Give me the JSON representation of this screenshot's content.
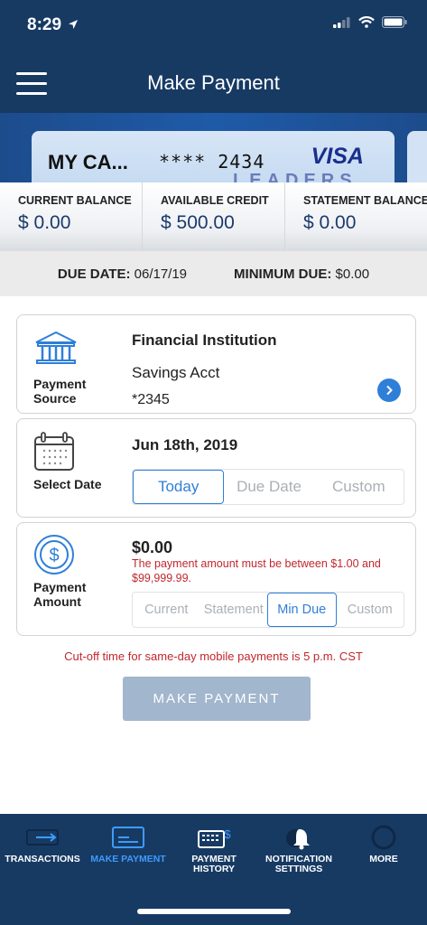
{
  "status": {
    "time": "8:29"
  },
  "header": {
    "title": "Make Payment"
  },
  "card": {
    "name": "MY CA...",
    "number": "**** 2434",
    "brand": "VISA",
    "ghost_text": "LEADERS"
  },
  "balances": [
    {
      "label": "CURRENT BALANCE",
      "value": "$ 0.00"
    },
    {
      "label": "AVAILABLE CREDIT",
      "value": "$ 500.00"
    },
    {
      "label": "STATEMENT BALANCE",
      "value": "$ 0.00"
    }
  ],
  "due": {
    "date_label": "DUE DATE:",
    "date_value": "06/17/19",
    "min_label": "MINIMUM DUE:",
    "min_value": "$0.00"
  },
  "payment_source": {
    "label_line1": "Payment",
    "label_line2": "Source",
    "title": "Financial Institution",
    "account": "Savings Acct",
    "account_number": "*2345"
  },
  "select_date": {
    "label": "Select Date",
    "value": "Jun 18th, 2019",
    "options": [
      "Today",
      "Due Date",
      "Custom"
    ],
    "selected": "Today"
  },
  "payment_amount": {
    "label_line1": "Payment",
    "label_line2": "Amount",
    "value": "$0.00",
    "error_line1": "The payment amount must be between $1.00 and",
    "error_line2": "$99,999.99.",
    "options": [
      "Current",
      "Statement",
      "Min Due",
      "Custom"
    ],
    "selected": "Min Due"
  },
  "cutoff_notice": "Cut-off time for same-day mobile payments is 5 p.m. CST",
  "make_payment_button": "MAKE PAYMENT",
  "tabs": [
    {
      "line1": "TRANSACTIONS",
      "line2": ""
    },
    {
      "line1": "MAKE PAYMENT",
      "line2": ""
    },
    {
      "line1": "PAYMENT",
      "line2": "HISTORY"
    },
    {
      "line1": "NOTIFICATION",
      "line2": "SETTINGS"
    },
    {
      "line1": "MORE",
      "line2": ""
    }
  ],
  "active_tab": "MAKE PAYMENT",
  "colors": {
    "navy": "#173a63",
    "accent": "#2f7fd8",
    "error": "#c1272d",
    "button_disabled": "#a2b6cd"
  }
}
